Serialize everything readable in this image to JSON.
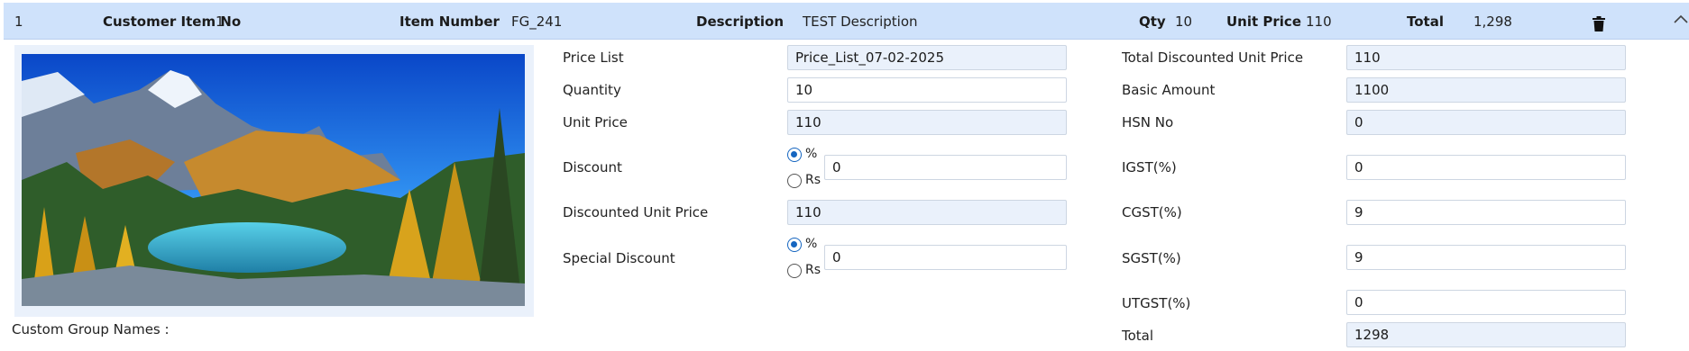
{
  "row": {
    "line_no": "1",
    "customer_item_label": "Customer Item No",
    "customer_item_value": "1",
    "item_number_label": "Item Number",
    "item_number_value": "FG_241",
    "description_label": "Description",
    "description_value": "TEST Description",
    "qty_label": "Qty",
    "qty_value": "10",
    "unit_price_label": "Unit Price",
    "unit_price_value": "110",
    "total_label": "Total",
    "total_value": "1,298",
    "delete_icon": "trash-icon",
    "collapse_icon": "chevron-up-icon"
  },
  "custom_group_label": "Custom Group Names :",
  "pricing": {
    "price_list_label": "Price List",
    "price_list_value": "Price_List_07-02-2025",
    "quantity_label": "Quantity",
    "quantity_value": "10",
    "unit_price_label": "Unit Price",
    "unit_price_value": "110",
    "discount_label": "Discount",
    "discount_percent_label": "%",
    "discount_rs_label": "Rs",
    "discount_selected": "%",
    "discount_value": "0",
    "discounted_unit_price_label": "Discounted Unit Price",
    "discounted_unit_price_value": "110",
    "special_discount_label": "Special Discount",
    "special_percent_label": "%",
    "special_rs_label": "Rs",
    "special_selected": "%",
    "special_discount_value": "0"
  },
  "tax": {
    "total_discounted_unit_price_label": "Total Discounted Unit Price",
    "total_discounted_unit_price_value": "110",
    "basic_amount_label": "Basic Amount",
    "basic_amount_value": "1100",
    "hsn_label": "HSN No",
    "hsn_value": "0",
    "igst_label": "IGST(%)",
    "igst_value": "0",
    "cgst_label": "CGST(%)",
    "cgst_value": "9",
    "sgst_label": "SGST(%)",
    "sgst_value": "9",
    "utgst_label": "UTGST(%)",
    "utgst_value": "0",
    "total_label": "Total",
    "total_value": "1298"
  },
  "colors": {
    "header_bg": "#cfe2fb",
    "readonly_field_bg": "#eaf1fb",
    "radio_accent": "#1565c0"
  }
}
